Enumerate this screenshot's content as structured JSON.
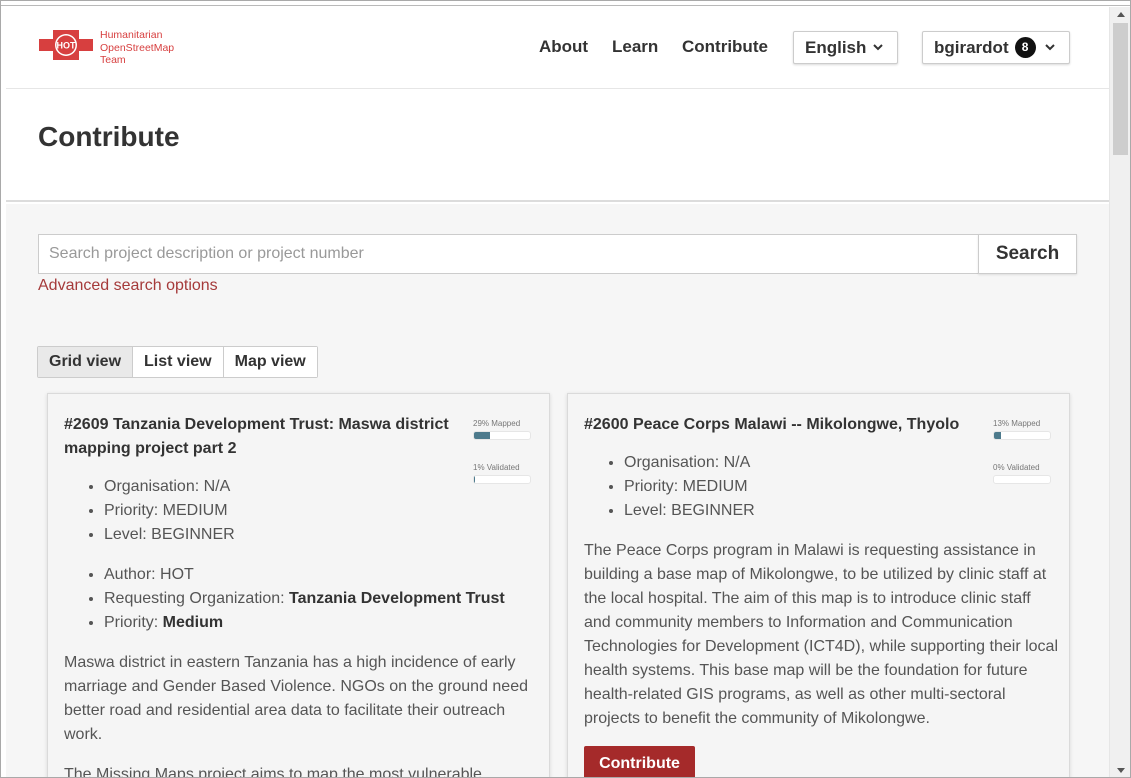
{
  "header": {
    "logo_abbr": "HOT",
    "logo_line1": "Humanitarian",
    "logo_line2": "OpenStreetMap",
    "logo_line3": "Team",
    "nav": [
      "About",
      "Learn",
      "Contribute"
    ],
    "language": "English",
    "username": "bgirardot",
    "notification_count": "8"
  },
  "page": {
    "title": "Contribute"
  },
  "search": {
    "placeholder": "Search project description or project number",
    "value": "",
    "button_label": "Search",
    "advanced_label": "Advanced search options"
  },
  "views": {
    "grid": "Grid view",
    "list": "List view",
    "map": "Map view",
    "active": "grid"
  },
  "projects": [
    {
      "title": "#2609 Tanzania Development Trust: Maswa district mapping project part 2",
      "mapped_label": "29% Mapped",
      "mapped_pct": 29,
      "validated_label": "1% Validated",
      "validated_pct": 1,
      "organisation": "Organisation: N/A",
      "priority": "Priority: MEDIUM",
      "level": "Level: BEGINNER",
      "author": "Author: HOT",
      "req_org_label": "Requesting Organization: ",
      "req_org_value": "Tanzania Development Trust",
      "priority2_label": "Priority: ",
      "priority2_value": "Medium",
      "description": "Maswa district in eastern Tanzania has a high incidence of early marriage and Gender Based Violence. NGOs on the ground need better road and residential area data to facilitate their outreach work.",
      "description2": "The Missing Maps project aims to map the most vulnerable"
    },
    {
      "title": "#2600 Peace Corps Malawi -- Mikolongwe, Thyolo",
      "mapped_label": "13% Mapped",
      "mapped_pct": 13,
      "validated_label": "0% Validated",
      "validated_pct": 0,
      "organisation": "Organisation: N/A",
      "priority": "Priority: MEDIUM",
      "level": "Level: BEGINNER",
      "description": "The Peace Corps program in Malawi is requesting assistance in building a base map of Mikolongwe, to be utilized by clinic staff at the local hospital. The aim of this map is to introduce clinic staff and community members to Information and Communication Technologies for Development (ICT4D), while supporting their local health systems. This base map will be the foundation for future health-related GIS programs, as well as other multi-sectoral projects to benefit the community of Mikolongwe.",
      "button_label": "Contribute"
    }
  ],
  "colors": {
    "brand": "#d73f3f",
    "button": "#a52a2a",
    "progress": "#4d7a8c"
  }
}
